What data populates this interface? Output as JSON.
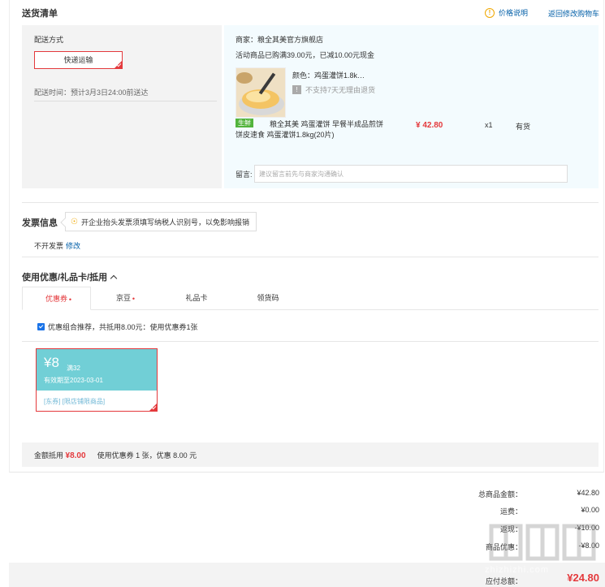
{
  "header": {
    "title": "送货清单",
    "price_note": "价格说明",
    "return_cart": "返回修改购物车"
  },
  "delivery": {
    "label": "配送方式",
    "option": "快递运输",
    "time": "配送时间：预计3月3日24:00前送达"
  },
  "order": {
    "merchant": "商家：粮全其美官方旗舰店",
    "promo": "活动商品已购满39.00元，已减10.00元现金",
    "color": "颜色：鸡蛋灌饼1.8k…",
    "no_return": "不支持7天无理由退货",
    "badge": "生鲜",
    "name": "粮全其美 鸡蛋灌饼 早餐半成品煎饼饼皮速食 鸡蛋灌饼1.8kg(20片)",
    "price": "¥ 42.80",
    "qty": "x1",
    "stock": "有货",
    "remark_label": "留言:",
    "remark_placeholder": "建议留言前先与商家沟通确认"
  },
  "invoice": {
    "title": "发票信息",
    "tip": "开企业抬头发票须填写纳税人识别号，以免影响报销",
    "status": "不开发票",
    "edit": "修改"
  },
  "coupons": {
    "title": "使用优惠/礼品卡/抵用",
    "tabs": [
      {
        "label": "优惠券",
        "mark": "•"
      },
      {
        "label": "京豆",
        "mark": "•"
      },
      {
        "label": "礼品卡",
        "mark": ""
      },
      {
        "label": "领货码",
        "mark": ""
      }
    ],
    "combo_text": "优惠组合推荐，共抵用8.00元：使用优惠券1张",
    "card": {
      "amount": "¥8",
      "condition": "满32",
      "validity": "有效期至2023-03-01",
      "scope": "[东券] [限店铺限商品]"
    },
    "summary_label": "金额抵用",
    "summary_amount": "¥8.00",
    "summary_text": "使用优惠券 1 张，优惠 8.00 元"
  },
  "totals": {
    "rows": [
      {
        "label": "总商品金额：",
        "value": "¥42.80"
      },
      {
        "label": "运费：",
        "value": "¥0.00"
      },
      {
        "label": "返现：",
        "value": "-¥10.00"
      },
      {
        "label": "商品优惠：",
        "value": "-¥8.00"
      }
    ],
    "pay_label": "应付总额：",
    "pay_value": "¥24.80"
  },
  "watermark": {
    "text": "zhizhizhi.com"
  },
  "colors": {
    "accent_red": "#e4393c",
    "link_blue": "#005ea7",
    "coupon_teal": "#71cfd6",
    "fresh_green": "#52b43c"
  }
}
